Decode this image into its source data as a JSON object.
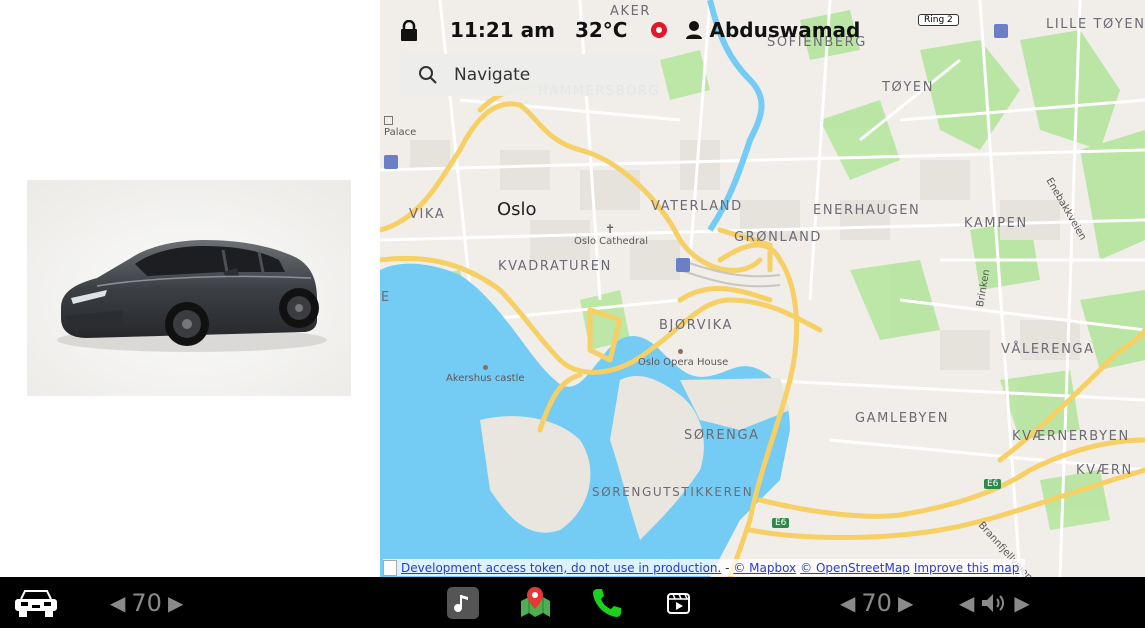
{
  "status": {
    "time": "11:21 am",
    "temperature": "32°C",
    "user": "Abduswamad"
  },
  "search": {
    "placeholder": "Navigate"
  },
  "map": {
    "city_label": "Oslo",
    "districts": [
      "AKER",
      "SOFIENBERG",
      "LILLE TØYEN",
      "TØYEN",
      "HAMMERSBORG",
      "VATERLAND",
      "ENERHAUGEN",
      "KAMPEN",
      "GRØNLAND",
      "VIKA",
      "KVADRATUREN",
      "BJØRVIKA",
      "VÅLERENGA",
      "GAMLEBYEN",
      "KVÆRNERBYEN",
      "KVÆRN",
      "SØRENGA",
      "SØRENGUTSTIKKEREN",
      "E"
    ],
    "pois": [
      "Palace",
      "Oslo Cathedral",
      "Oslo Opera House",
      "Akershus castle"
    ],
    "roads": [
      "Ring 2",
      "E6",
      "E6",
      "Enebakkveien",
      "Brinken",
      "Brannfjellveien"
    ],
    "attribution": {
      "dev_token": "Development access token, do not use in production.",
      "sep": " - ",
      "mapbox": "© Mapbox",
      "osm": "© OpenStreetMap",
      "improve": "Improve this map"
    }
  },
  "bottom_bar": {
    "left_temp": "70",
    "right_temp": "70"
  },
  "colors": {
    "water": "#74ccf4",
    "park": "#b6e59e",
    "road_major": "#f6cf65",
    "land": "#f1eeea",
    "bottom_bar": "#000000",
    "phone_green": "#1bd11b"
  }
}
